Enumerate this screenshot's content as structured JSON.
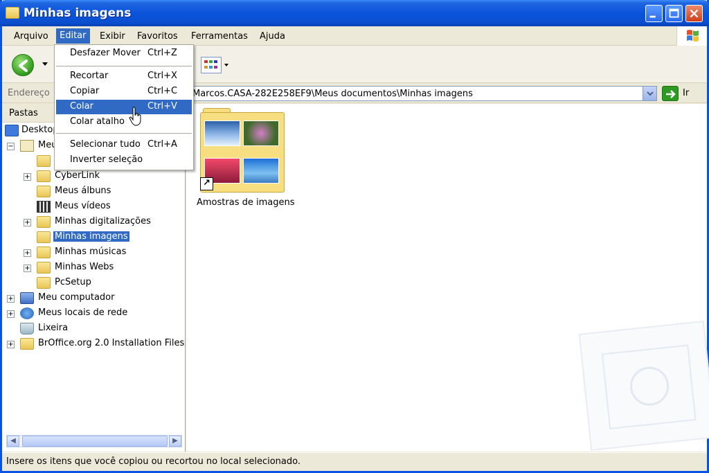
{
  "window": {
    "title": "Minhas imagens"
  },
  "menubar": {
    "items": [
      "Arquivo",
      "Editar",
      "Exibir",
      "Favoritos",
      "Ferramentas",
      "Ajuda"
    ],
    "active": "Editar"
  },
  "edit_menu": {
    "items": [
      {
        "label": "Desfazer Mover",
        "shortcut": "Ctrl+Z"
      },
      {
        "label": "Recortar",
        "shortcut": "Ctrl+X"
      },
      {
        "label": "Copiar",
        "shortcut": "Ctrl+C"
      },
      {
        "label": "Colar",
        "shortcut": "Ctrl+V"
      },
      {
        "label": "Colar atalho",
        "shortcut": ""
      },
      {
        "label": "Selecionar tudo",
        "shortcut": "Ctrl+A"
      },
      {
        "label": "Inverter seleção",
        "shortcut": ""
      }
    ],
    "highlighted": "Colar"
  },
  "address": {
    "label": "Endereço",
    "value": "Marcos.CASA-282E258EF9\\Meus documentos\\Minhas imagens",
    "go_label": "Ir"
  },
  "folders_pane": {
    "title": "Pastas",
    "items": [
      {
        "label": "Desktop"
      },
      {
        "label": "Meus documentos"
      },
      {
        "label": ""
      },
      {
        "label": "CyberLink"
      },
      {
        "label": "Meus álbuns"
      },
      {
        "label": "Meus vídeos"
      },
      {
        "label": "Minhas digitalizações"
      },
      {
        "label": "Minhas imagens"
      },
      {
        "label": "Minhas músicas"
      },
      {
        "label": "Minhas Webs"
      },
      {
        "label": "PcSetup"
      },
      {
        "label": "Meu computador"
      },
      {
        "label": "Meus locais de rede"
      },
      {
        "label": "Lixeira"
      },
      {
        "label": "BrOffice.org 2.0 Installation Files"
      }
    ],
    "selected": "Minhas imagens"
  },
  "content": {
    "items": [
      {
        "label": "Amostras de imagens"
      }
    ]
  },
  "status": {
    "text": "Insere os itens que você copiou ou recortou no local selecionado."
  },
  "colors": {
    "selection": "#316AC5",
    "titlebar": "#0A54DB",
    "window_bg": "#ECE9D8"
  }
}
